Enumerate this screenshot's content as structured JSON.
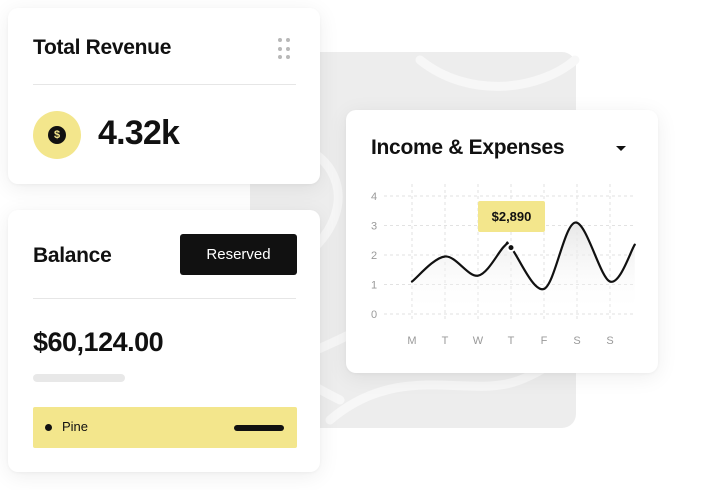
{
  "theme": {
    "accent": "#f3e68c",
    "dark": "#111111",
    "background_panel": "#ededed"
  },
  "revenue_card": {
    "title": "Total Revenue",
    "menu_icon": "drag-handle-icon",
    "coin_icon": "dollar-coin-icon",
    "coin_symbol": "$",
    "value": "4.32k"
  },
  "balance_card": {
    "title": "Balance",
    "status_button": "Reserved",
    "amount": "$60,124.00",
    "account_row": {
      "label": "Pine"
    }
  },
  "income_card": {
    "title": "Income & Expenses",
    "dropdown_icon": "caret-down-icon",
    "tooltip_value": "$2,890",
    "chart_data": {
      "type": "line",
      "categories": [
        "M",
        "T",
        "W",
        "T",
        "F",
        "S",
        "S"
      ],
      "y_ticks": [
        0,
        1,
        2,
        3,
        4
      ],
      "ylim": [
        0,
        4
      ],
      "grid": true,
      "points": [
        {
          "x": 0.0,
          "y": 1.1
        },
        {
          "x": 1.0,
          "y": 1.95
        },
        {
          "x": 2.0,
          "y": 1.3
        },
        {
          "x": 2.8,
          "y": 2.3
        },
        {
          "x": 3.0,
          "y": 2.25
        },
        {
          "x": 4.0,
          "y": 0.85
        },
        {
          "x": 4.95,
          "y": 3.1
        },
        {
          "x": 6.0,
          "y": 1.1
        },
        {
          "x": 6.75,
          "y": 2.35
        }
      ],
      "highlight": {
        "x": 3.0,
        "y": 2.25,
        "label": "$2,890"
      },
      "title": "",
      "xlabel": "",
      "ylabel": ""
    }
  }
}
